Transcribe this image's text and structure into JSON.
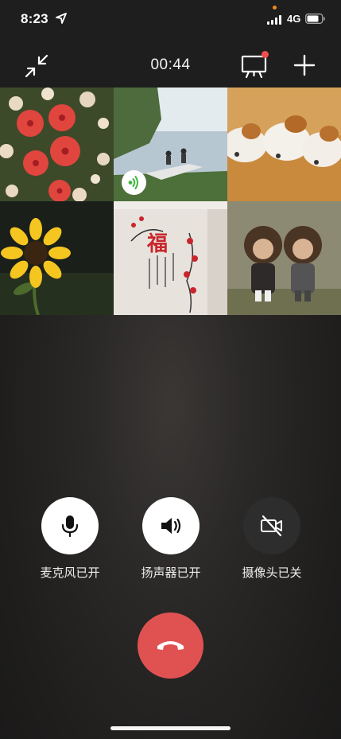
{
  "status_bar": {
    "time": "8:23",
    "network": "4G",
    "icons": [
      "location-arrow-icon",
      "cellular-signal-icon",
      "battery-icon"
    ]
  },
  "call": {
    "duration": "00:44",
    "icons": [
      "minimize-icon",
      "screen-share-icon",
      "add-participant-icon"
    ],
    "notification_dot_color": "#f24e4e"
  },
  "participants": [
    {
      "subject": "red flowers",
      "speaking": false
    },
    {
      "subject": "lake with dock",
      "speaking": true
    },
    {
      "subject": "sleeping puppies",
      "speaking": false
    },
    {
      "subject": "sunflower",
      "speaking": false
    },
    {
      "subject": "fu character wall decal",
      "speaking": false
    },
    {
      "subject": "dolls couple",
      "speaking": false
    }
  ],
  "controls": [
    {
      "label": "麦克风已开",
      "icon": "microphone-icon",
      "state": "on"
    },
    {
      "label": "扬声器已开",
      "icon": "speaker-icon",
      "state": "on"
    },
    {
      "label": "摄像头已关",
      "icon": "camera-off-icon",
      "state": "off"
    }
  ],
  "hangup": {
    "icon": "hangup-icon",
    "color": "#e05252"
  },
  "colors": {
    "accent_red": "#e05252",
    "speaking_green": "#3cb83c"
  }
}
